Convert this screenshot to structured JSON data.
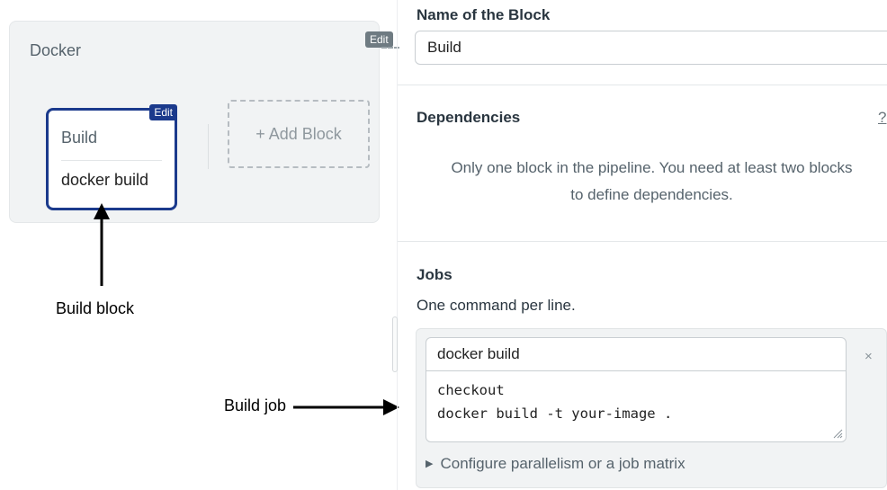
{
  "canvas": {
    "pipeline": {
      "title": "Docker",
      "edit_label": "Edit",
      "block": {
        "edit_label": "Edit",
        "name": "Build",
        "job": "docker build"
      },
      "add_block_label": "+ Add Block"
    },
    "annotations": {
      "block_label": "Build block",
      "job_label": "Build job"
    }
  },
  "panel": {
    "name_section": {
      "heading": "Name of the Block",
      "value": "Build"
    },
    "dependencies": {
      "heading": "Dependencies",
      "help": "?",
      "message_line1": "Only one block in the pipeline. You need at least two blocks",
      "message_line2": "to define dependencies."
    },
    "jobs": {
      "heading": "Jobs",
      "subtitle": "One command per line.",
      "job_name": "docker build",
      "commands": "checkout\ndocker build -t your-image .",
      "remove_icon": "×",
      "parallelism_link": "Configure parallelism or a job matrix"
    }
  }
}
